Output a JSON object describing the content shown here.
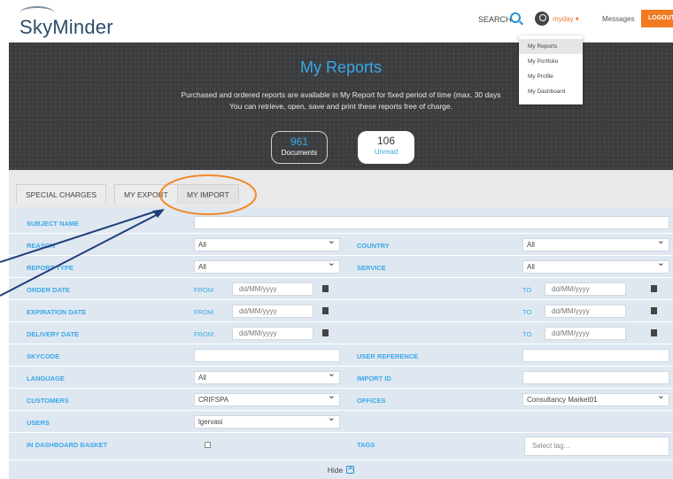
{
  "header": {
    "logo": "SkyMinder",
    "search_label": "SEARCH",
    "user_label": "myday ▾",
    "messages_label": "Messages",
    "logout_label": "LOGOUT",
    "accent_color": "#f07b22"
  },
  "user_menu": {
    "items": [
      "My Reports",
      "My Portfolio",
      "My Profile",
      "My Dashboard"
    ],
    "active": "My Reports"
  },
  "hero": {
    "title": "My Reports",
    "desc_line1": "Purchased and ordered reports are available in My Report for fixed period of time (max. 30 days",
    "desc_line2": "You can retrieve, open, save and print these reports free of charge.",
    "documents_count": "961",
    "documents_label": "Documents",
    "unread_count": "106",
    "unread_label": "Unread"
  },
  "tabs": [
    {
      "label": "SPECIAL CHARGES"
    },
    {
      "label": "MY EXPORT"
    },
    {
      "label": "MY IMPORT"
    }
  ],
  "form": {
    "subject_name": {
      "label": "SUBJECT NAME",
      "value": ""
    },
    "reason": {
      "label": "REASON",
      "value": "All"
    },
    "country": {
      "label": "COUNTRY",
      "value": "All"
    },
    "report_type": {
      "label": "REPORT TYPE",
      "value": "All"
    },
    "service": {
      "label": "SERVICE",
      "value": "All"
    },
    "order_date": {
      "label": "ORDER DATE",
      "from_label": "FROM",
      "to_label": "TO",
      "placeholder": "dd/MM/yyyy"
    },
    "expiration_date": {
      "label": "EXPIRATION DATE",
      "from_label": "FROM",
      "to_label": "TO",
      "placeholder": "dd/MM/yyyy"
    },
    "delivery_date": {
      "label": "DELIVERY DATE",
      "from_label": "FROM",
      "to_label": "TO",
      "placeholder": "dd/MM/yyyy"
    },
    "skycode": {
      "label": "SKYCODE",
      "value": ""
    },
    "user_reference": {
      "label": "USER REFERENCE",
      "value": ""
    },
    "language": {
      "label": "LANGUAGE",
      "value": "All"
    },
    "import_id": {
      "label": "IMPORT ID",
      "value": ""
    },
    "customers": {
      "label": "CUSTOMERS",
      "value": "CRIFSPA"
    },
    "offices": {
      "label": "OFFICES",
      "value": "Consultancy Market01"
    },
    "users": {
      "label": "USERS",
      "value": "lgervasi"
    },
    "in_dashboard_basket": {
      "label": "IN DASHBOARD BASKET"
    },
    "tags": {
      "label": "TAGS",
      "placeholder": "Select tag..."
    },
    "hide_label": "Hide"
  }
}
